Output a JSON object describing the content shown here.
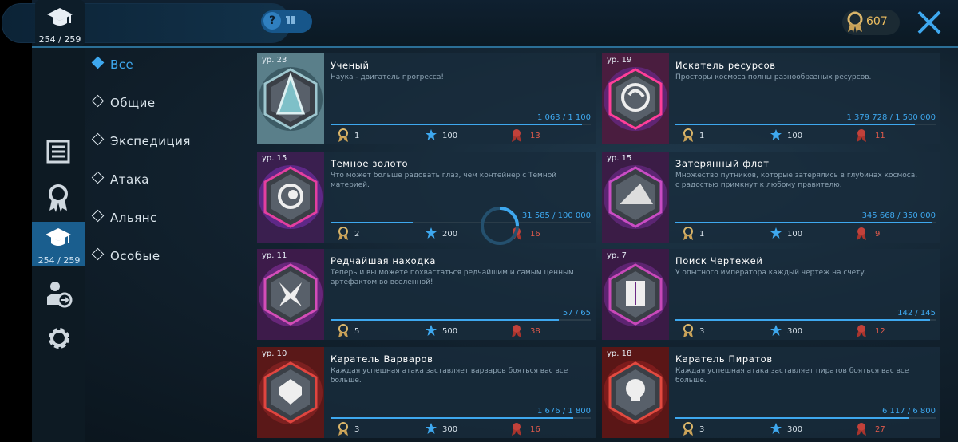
{
  "topbar": {
    "level_progress": "254 / 259",
    "help_label": "?",
    "medals": "607"
  },
  "nav": {
    "items": [
      "document-icon",
      "medal-icon",
      "graduation-cap-icon",
      "player-relations-icon",
      "gear-icon"
    ],
    "active_count": "254 / 259"
  },
  "categories": [
    {
      "label": "Все",
      "active": true
    },
    {
      "label": "Общие",
      "active": false
    },
    {
      "label": "Экспедиция",
      "active": false
    },
    {
      "label": "Атака",
      "active": false
    },
    {
      "label": "Альянс",
      "active": false
    },
    {
      "label": "Особые",
      "active": false
    }
  ],
  "achievements": [
    {
      "level": "ур. 23",
      "title": "Ученый",
      "desc": "Наука - двигатель прогресса!",
      "progress": "1 063 / 1 100",
      "fill": 0.966,
      "medals": "1",
      "stars": "100",
      "ribbons": "13",
      "icon": "flask-icon"
    },
    {
      "level": "ур. 19",
      "title": "Искатель ресурсов",
      "desc": "Просторы космоса полны разнообразных ресурсов.",
      "progress": "1 379 728 / 1 500 000",
      "fill": 0.92,
      "medals": "1",
      "stars": "100",
      "ribbons": "11",
      "icon": "vortex-icon"
    },
    {
      "level": "ур. 15",
      "title": "Темное золото",
      "desc": "Что может больше радовать глаз, чем контейнер с Темной материей.",
      "progress": "31 585 / 100 000",
      "fill": 0.316,
      "medals": "2",
      "stars": "200",
      "ribbons": "16",
      "icon": "dark-matter-icon"
    },
    {
      "level": "ур. 15",
      "title": "Затерянный флот",
      "desc": "Множество путников, которые затерялись в глубинах космоса, с радостью примкнут к любому правителю.",
      "progress": "345 668 / 350 000",
      "fill": 0.988,
      "medals": "1",
      "stars": "100",
      "ribbons": "9",
      "icon": "ship-icon"
    },
    {
      "level": "ур. 11",
      "title": "Редчайшая находка",
      "desc": "Теперь и вы можете похвастаться редчайшим и самым ценным артефактом во вселенной!",
      "progress": "57 / 65",
      "fill": 0.877,
      "medals": "5",
      "stars": "500",
      "ribbons": "38",
      "icon": "artifact-icon"
    },
    {
      "level": "ур. 7",
      "title": "Поиск Чертежей",
      "desc": "У опытного императора каждый чертеж на счету.",
      "progress": "142 / 145",
      "fill": 0.979,
      "medals": "3",
      "stars": "300",
      "ribbons": "12",
      "icon": "blueprint-icon"
    },
    {
      "level": "ур. 10",
      "title": "Каратель Варваров",
      "desc": "Каждая успешная атака заставляет варваров бояться вас все больше.",
      "progress": "1 676 / 1 800",
      "fill": 0.931,
      "medals": "3",
      "stars": "300",
      "ribbons": "16",
      "icon": "barbarian-icon"
    },
    {
      "level": "ур. 18",
      "title": "Каратель Пиратов",
      "desc": "Каждая успешная атака заставляет пиратов бояться вас все больше.",
      "progress": "6 117 / 6 800",
      "fill": 0.9,
      "medals": "3",
      "stars": "300",
      "ribbons": "27",
      "icon": "skull-icon"
    }
  ],
  "colors": {
    "accent": "#3ea8ef",
    "ribbon": "#e05a4c",
    "medal": "#f0c060"
  }
}
